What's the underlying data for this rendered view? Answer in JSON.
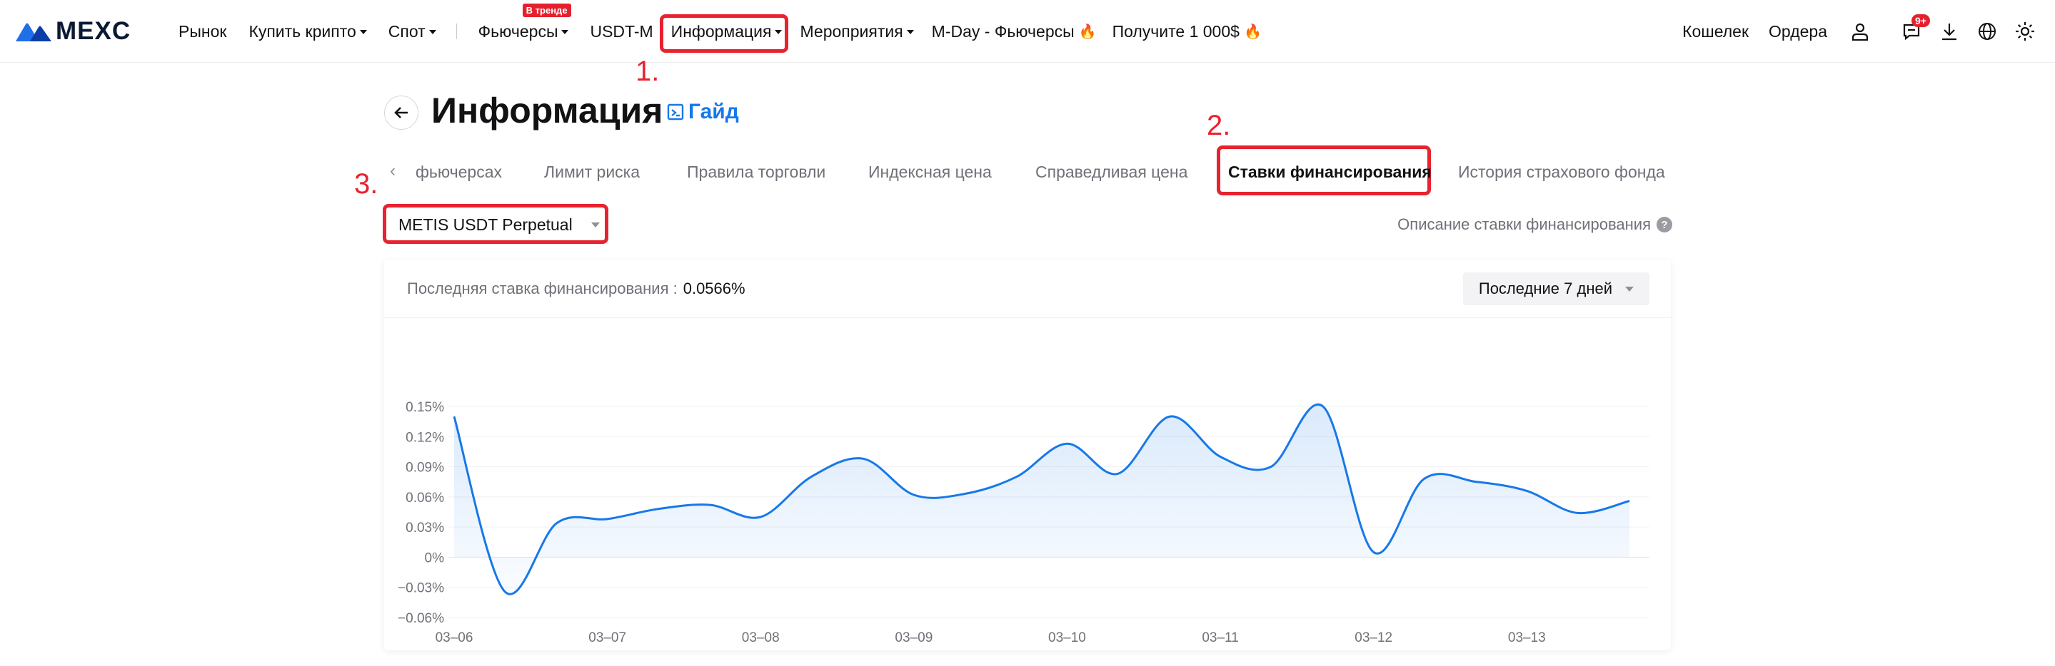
{
  "nav": {
    "logo_text": "MEXC",
    "items": [
      {
        "label": "Рынок",
        "caret": false
      },
      {
        "label": "Купить крипто",
        "caret": true
      },
      {
        "label": "Спот",
        "caret": true
      },
      {
        "label": "Фьючерсы",
        "caret": true,
        "badge": "В тренде"
      },
      {
        "label": "USDT-M",
        "caret": false
      },
      {
        "label": "Информация",
        "caret": true
      },
      {
        "label": "Мероприятия",
        "caret": true
      },
      {
        "label": "M-Day - Фьючерсы",
        "caret": false,
        "fire": true
      },
      {
        "label": "Получите 1 000$",
        "caret": false,
        "fire": true
      }
    ],
    "right": {
      "wallet": "Кошелек",
      "orders": "Ордера",
      "notif_badge": "9+"
    }
  },
  "annotations": {
    "step1": "1.",
    "step2": "2.",
    "step3": "3."
  },
  "page": {
    "title": "Информация",
    "guide": "Гайд"
  },
  "tabs": [
    {
      "label": "фьючерсах",
      "active": false
    },
    {
      "label": "Лимит риска",
      "active": false
    },
    {
      "label": "Правила торговли",
      "active": false
    },
    {
      "label": "Индексная цена",
      "active": false
    },
    {
      "label": "Справедливая цена",
      "active": false
    },
    {
      "label": "Ставки финансирования",
      "active": true
    },
    {
      "label": "История страхового фонда",
      "active": false
    }
  ],
  "contract": {
    "selected": "METIS USDT Perpetual"
  },
  "description_link": "Описание ставки финансирования",
  "card": {
    "last_rate_label": "Последняя ставка финансирования :",
    "last_rate_value": "0.0566%",
    "period": "Последние 7 дней"
  },
  "colors": {
    "accent": "#1778e9",
    "line": "#1778e9",
    "annotation": "#e8222e"
  },
  "chart_data": {
    "type": "area",
    "title": "",
    "xlabel": "",
    "ylabel": "",
    "x_ticks": [
      "03–06",
      "03–07",
      "03–08",
      "03–09",
      "03–10",
      "03–11",
      "03–12",
      "03–13"
    ],
    "y_ticks": [
      0.15,
      0.12,
      0.09,
      0.06,
      0.03,
      0,
      -0.03,
      -0.06
    ],
    "y_tick_labels": [
      "0.15%",
      "0.12%",
      "0.09%",
      "0.06%",
      "0.03%",
      "0%",
      "−0.03%",
      "−0.06%"
    ],
    "ylim": [
      -0.06,
      0.15
    ],
    "xlim": [
      0,
      7.8
    ],
    "grid": true,
    "series": [
      {
        "x": [
          0,
          0.33,
          0.67,
          1,
          1.33,
          1.67,
          2,
          2.33,
          2.67,
          3,
          3.33,
          3.67,
          4,
          4.33,
          4.67,
          5,
          5.33,
          5.67,
          6,
          6.33,
          6.67,
          7,
          7.33,
          7.67
        ],
        "values": [
          0.14,
          -0.034,
          0.034,
          0.038,
          0.048,
          0.052,
          0.04,
          0.08,
          0.098,
          0.062,
          0.063,
          0.08,
          0.113,
          0.083,
          0.14,
          0.1,
          0.09,
          0.15,
          0.005,
          0.078,
          0.075,
          0.066,
          0.044,
          0.056
        ]
      }
    ]
  }
}
